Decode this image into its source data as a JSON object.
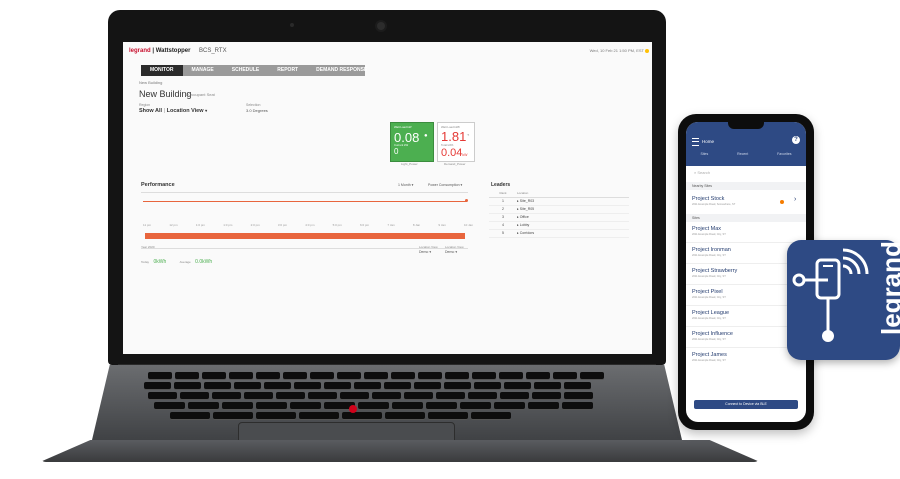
{
  "laptop": {
    "logo_brand": "legrand",
    "logo_product": "Wattstopper",
    "site_code": "BCS_RTX",
    "datetime": "Wed, 10 Feb 21  1:50 PM, EST",
    "nav_tabs": [
      "MONITOR",
      "MANAGE",
      "SCHEDULE",
      "REPORT",
      "DEMAND RESPONSE"
    ],
    "breadcrumb": "New Building",
    "building_title": "New Building",
    "building_subtitle": "4 Occupant Seat",
    "region_label": "Region",
    "region_value": "Show All",
    "location_view": "Location View",
    "selection_label": "Selection",
    "selection_value": "3.0 Degrees",
    "card_left": {
      "top_label": "Watt Load  kW",
      "top_value": "0.08",
      "bottom_label": "Current  kW",
      "bottom_value": "0",
      "caption": "Light_Power"
    },
    "card_right": {
      "top_label": "Watt Load  kWh",
      "top_value": "1.81",
      "bottom_label": "Total  kWh",
      "bottom_value": "0.04",
      "bottom_unit": "kW",
      "caption": "Demand_Power"
    },
    "performance_title": "Performance",
    "perf_controls": [
      "1 Month",
      "Power Consumption"
    ],
    "time_ticks": [
      "11 pm",
      "12 pm",
      "1:0 pm",
      "1:0 pm",
      "2:0 pm",
      "3:0 pm",
      "4:0 pm",
      "5:0 pm",
      "6:0 pm",
      "7 Jan",
      "8 Jan",
      "9 Jan",
      "10 Jan"
    ],
    "footer": {
      "label": "Year 2020",
      "today_label": "Today",
      "today_value": "0kWh",
      "average_label": "Average",
      "average_value": "0.0kWh",
      "sel1_label": "Location View",
      "sel1_value": "Demo",
      "sel2_label": "Location View",
      "sel2_value": "Demo"
    },
    "leaders": {
      "title": "Leaders",
      "col_rank": "Rank",
      "col_location": "Location",
      "rows": [
        {
          "rank": "1",
          "location": "Site_R03"
        },
        {
          "rank": "2",
          "location": "Site_R05"
        },
        {
          "rank": "3",
          "location": "Office"
        },
        {
          "rank": "4",
          "location": "Lobby"
        },
        {
          "rank": "5",
          "location": "Corridors"
        }
      ]
    }
  },
  "phone": {
    "app_title": "Home",
    "tabs": [
      "Sites",
      "Recent",
      "Favorites"
    ],
    "search_placeholder": "Search",
    "section_nearby": "Nearby Sites",
    "section_sites": "Sites",
    "nearby_item": {
      "title": "Project Stock",
      "subtitle": "2011 Example Road, Somewhere, ST"
    },
    "items": [
      {
        "title": "Project Max",
        "subtitle": "2011 Example Road, City, ST"
      },
      {
        "title": "Project Ironman",
        "subtitle": "2011 Example Road, City, ST"
      },
      {
        "title": "Project Strawberry",
        "subtitle": "2011 Example Road, City, ST"
      },
      {
        "title": "Project Pixel",
        "subtitle": "2011 Example Road, City, ST"
      },
      {
        "title": "Project League",
        "subtitle": "2011 Example Road, City, ST"
      },
      {
        "title": "Project Influence",
        "subtitle": "2011 Example Road, City, ST"
      },
      {
        "title": "Project James",
        "subtitle": "2011 Example Road, City, ST"
      }
    ],
    "bottom_button": "Connect to Device via BLE"
  },
  "app_icon": {
    "brand": "legrand",
    "color": "#2e4a84"
  },
  "colors": {
    "accent_green": "#4caf50",
    "accent_red": "#e53935",
    "series_orange": "#e8653d",
    "legrand_red": "#c8102e",
    "phone_blue": "#2e4a84"
  }
}
